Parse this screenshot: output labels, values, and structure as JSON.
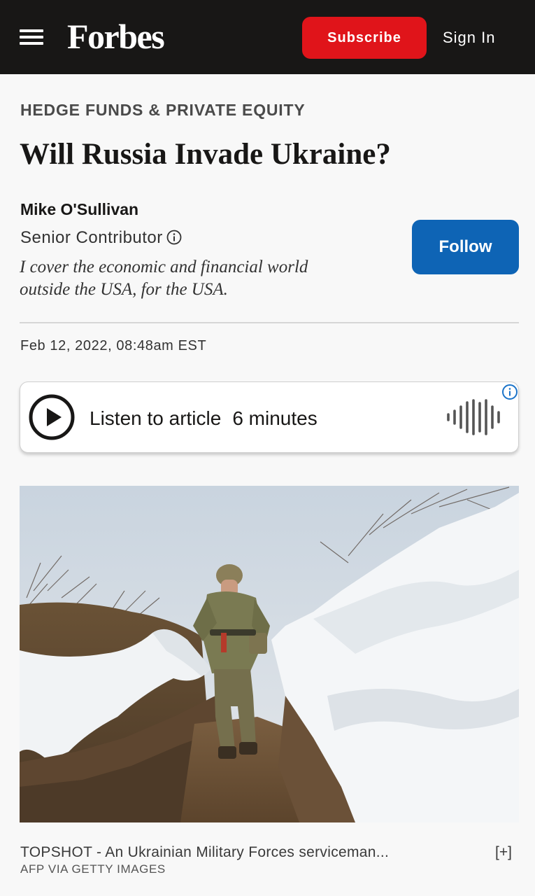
{
  "header": {
    "menu_icon": "hamburger-menu-icon",
    "logo": "Forbes",
    "subscribe_label": "Subscribe",
    "signin_label": "Sign In",
    "bar_color": "#181716",
    "subscribe_color": "#e0141a"
  },
  "article": {
    "kicker": "HEDGE FUNDS & PRIVATE EQUITY",
    "title": "Will Russia Invade Ukraine?",
    "author": {
      "name": "Mike O'Sullivan",
      "role": "Senior Contributor",
      "role_icon": "info-circle-icon",
      "bio_line1": "I cover the economic and financial world",
      "bio_line2": "outside the USA, for the USA.",
      "follow_label": "Follow",
      "follow_color": "#0e64b5"
    },
    "date": "Feb 12, 2022,",
    "time": "08:48am EST"
  },
  "audio_player": {
    "play_icon": "play-circle-icon",
    "label": "Listen to article",
    "duration": "6 minutes",
    "wave_icon": "audio-waveform-icon",
    "info_icon": "info-circle-icon",
    "info_color": "#1a73c9"
  },
  "photo": {
    "subject": "soldier-in-snowy-trench-image",
    "caption": "TOPSHOT - An Ukrainian Military Forces serviceman...",
    "expand_label": "[+]",
    "credit": "AFP VIA GETTY IMAGES"
  }
}
